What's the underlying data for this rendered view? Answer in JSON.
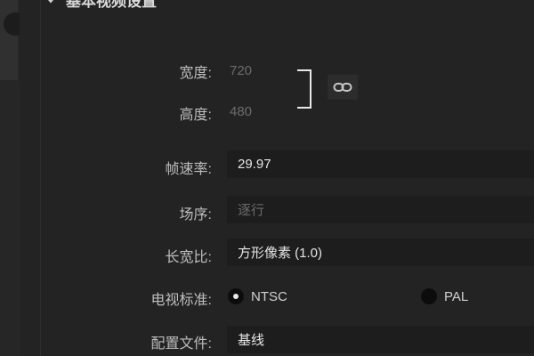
{
  "section": {
    "title": "基本视频设置",
    "collapse_icon": "chevron-down-icon"
  },
  "width": {
    "label": "宽度:",
    "value": "720"
  },
  "height": {
    "label": "高度:",
    "value": "480"
  },
  "link_toggle": {
    "icon": "link-icon"
  },
  "frame_rate": {
    "label": "帧速率:",
    "value": "29.97"
  },
  "field_order": {
    "label": "场序:",
    "value": "逐行"
  },
  "aspect_ratio": {
    "label": "长宽比:",
    "value": "方形像素 (1.0)"
  },
  "tv_standard": {
    "label": "电视标准:",
    "options": [
      {
        "label": "NTSC",
        "selected": true
      },
      {
        "label": "PAL",
        "selected": false
      }
    ]
  },
  "profile": {
    "label": "配置文件:",
    "value": "基线"
  }
}
